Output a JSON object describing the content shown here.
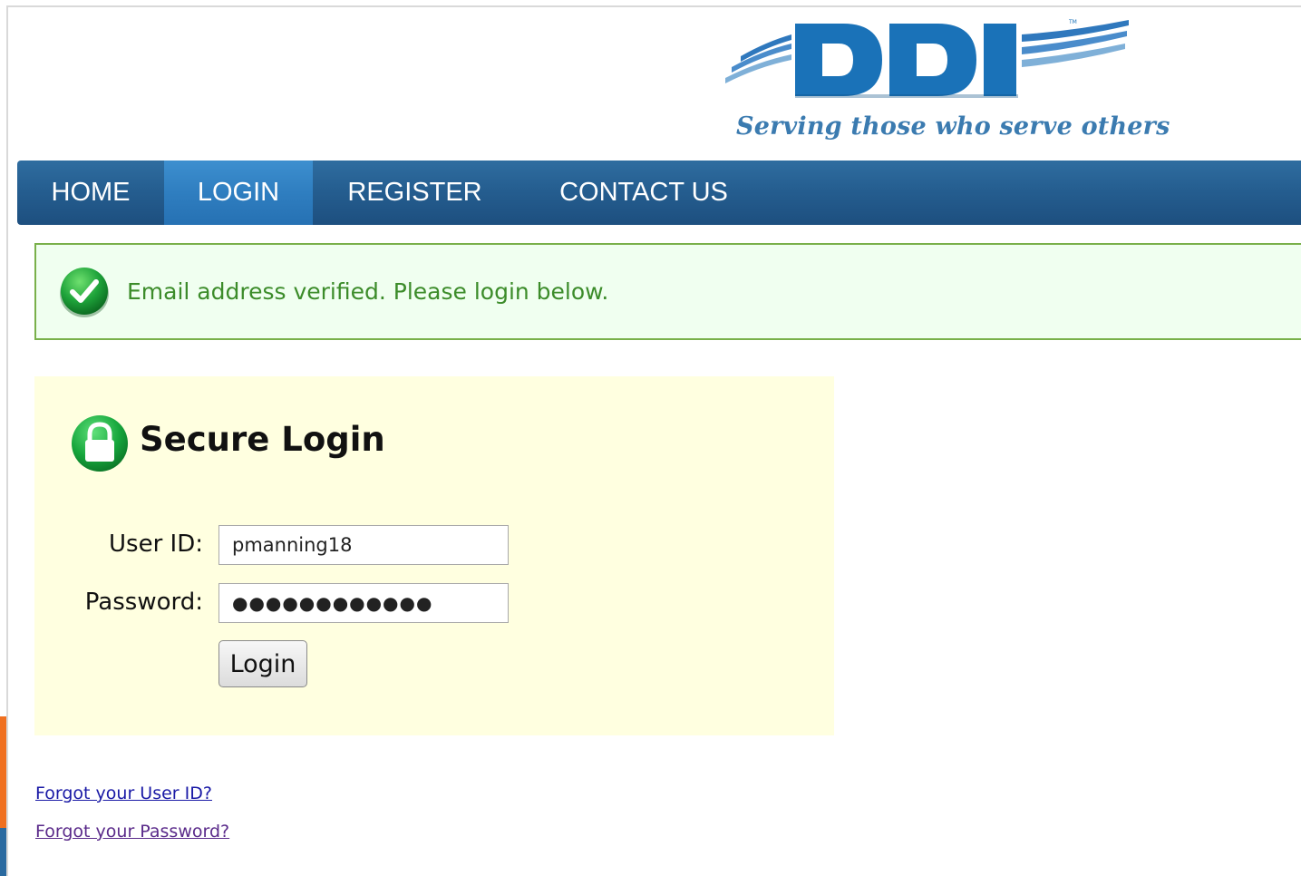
{
  "logo": {
    "text": "DDI",
    "tm": "TM",
    "brand_color": "#1a72b8"
  },
  "tagline": "Serving those who serve others",
  "nav": {
    "items": [
      {
        "label": "HOME",
        "active": false
      },
      {
        "label": "LOGIN",
        "active": true
      },
      {
        "label": "REGISTER",
        "active": false
      },
      {
        "label": "CONTACT US",
        "active": false
      }
    ]
  },
  "banner": {
    "icon": "check-circle-icon",
    "message": "Email address verified. Please login below.",
    "color": "#3c8c2a"
  },
  "login": {
    "icon": "lock-icon",
    "title": "Secure Login",
    "user_id_label": "User ID:",
    "user_id_value": "pmanning18",
    "password_label": "Password:",
    "password_value": "●●●●●●●●●●●●",
    "button_label": "Login"
  },
  "links": {
    "forgot_user_id": "Forgot your User ID?",
    "forgot_password": "Forgot your Password?"
  }
}
